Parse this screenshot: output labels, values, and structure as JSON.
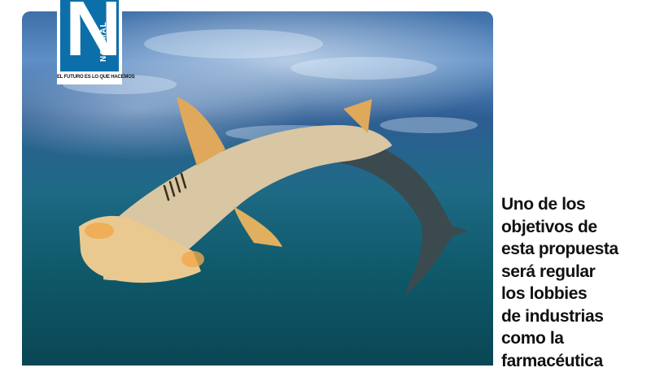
{
  "logo": {
    "letter": "N",
    "wordmark": "NORMAL",
    "tagline": "EL FUTURO ES LO QUE HACEMOS",
    "brand_color": "#0d6fa9"
  },
  "photo": {
    "icon": "hammerhead-shark-photo"
  },
  "quote": {
    "lines": [
      "Uno de los",
      "objetivos de",
      "esta propuesta",
      "será regular",
      "los lobbies",
      "de industrias",
      "como la",
      "farmacéutica"
    ]
  }
}
